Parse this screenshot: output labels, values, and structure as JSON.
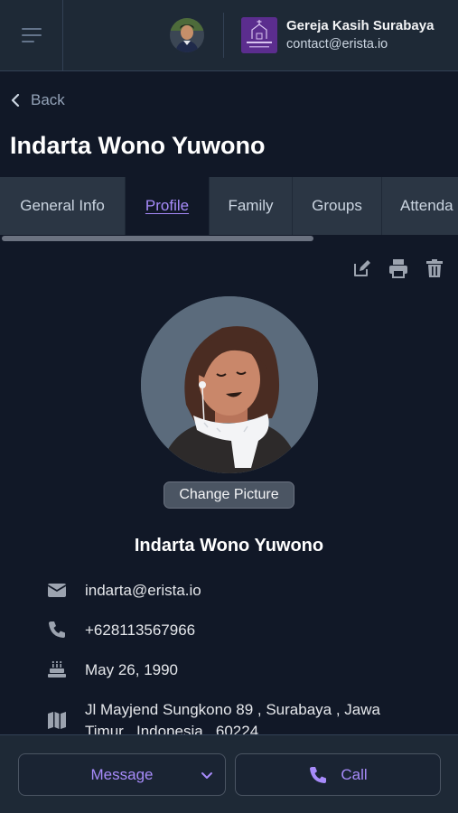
{
  "header": {
    "org_name": "Gereja Kasih Surabaya",
    "org_email": "contact@erista.io",
    "logo_text": "GEREJA KASIH"
  },
  "nav": {
    "back_label": "Back"
  },
  "page": {
    "title": "Indarta Wono Yuwono"
  },
  "tabs": [
    {
      "label": "General Info",
      "active": false
    },
    {
      "label": "Profile",
      "active": true
    },
    {
      "label": "Family",
      "active": false
    },
    {
      "label": "Groups",
      "active": false
    },
    {
      "label": "Attenda",
      "active": false
    }
  ],
  "actions": {
    "icons": [
      "edit-icon",
      "print-icon",
      "trash-icon"
    ]
  },
  "profile": {
    "change_picture_label": "Change Picture",
    "name": "Indarta Wono Yuwono",
    "email": "indarta@erista.io",
    "phone": "+628113567966",
    "birthday": "May 26, 1990",
    "address": "Jl Mayjend Sungkono 89 , Surabaya , Jawa Timur , Indonesia , 60224"
  },
  "footer": {
    "message_label": "Message",
    "call_label": "Call"
  },
  "colors": {
    "accent": "#a78bfa",
    "background": "#111827",
    "surface": "#1e2936"
  }
}
